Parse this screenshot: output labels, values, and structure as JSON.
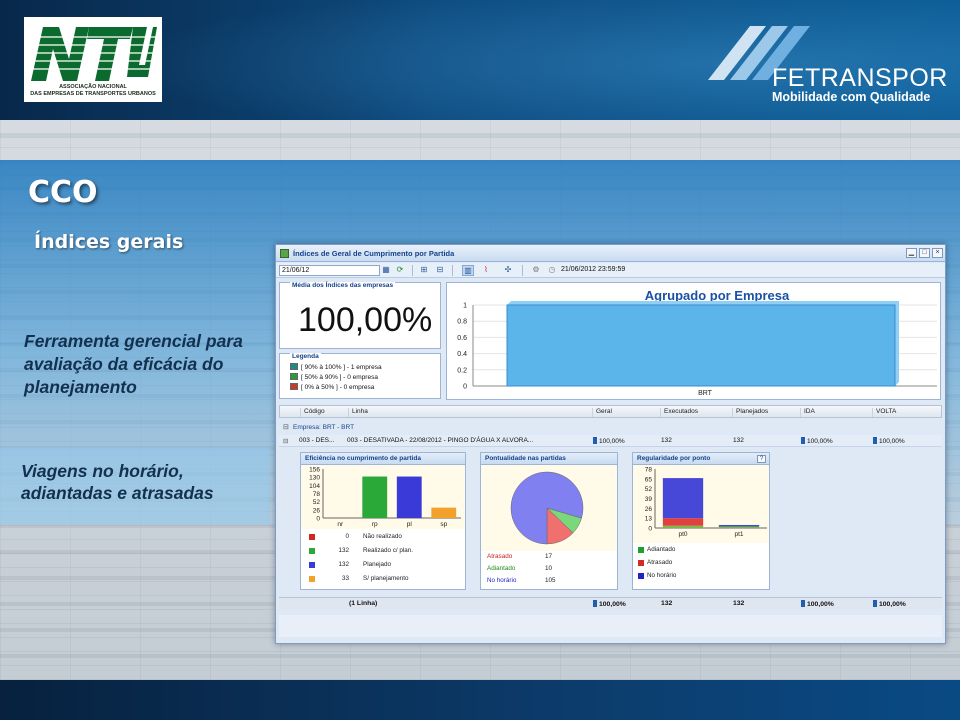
{
  "slide": {
    "title": "CCO",
    "subtitle": "Índices gerais",
    "tool_text": "Ferramenta gerencial para avaliação da eficácia do planejamento",
    "trips_text": "Viagens no horário, adiantadas e atrasadas"
  },
  "logos": {
    "ntu_mark": "NTU",
    "ntu_sub_1": "ASSOCIAÇÃO NACIONAL",
    "ntu_sub_2": "DAS EMPRESAS DE TRANSPORTES URBANOS",
    "fet_name": "FETRANSPOR",
    "fet_tagline": "Mobilidade com Qualidade"
  },
  "window": {
    "title": "Índices de Geral de Cumprimento por Partida",
    "date_value": "21/06/12",
    "datetime": "21/06/2012 23:59:59",
    "media_label": "Média dos Índices das empresas",
    "media_value": "100,00%",
    "legend_label": "Legenda",
    "legend": [
      {
        "text": "[ 90% à 100% ] - 1 empresa",
        "color": "#1f8a8a"
      },
      {
        "text": "[ 50% à 90% ] - 0 empresa",
        "color": "#2a9a3a"
      },
      {
        "text": "[ 0% à 50% ] - 0 empresa",
        "color": "#c83a2a"
      }
    ]
  },
  "columns": [
    "Código",
    "Linha",
    "Geral",
    "Executados",
    "Planejados",
    "IDA",
    "VOLTA"
  ],
  "group_label": "Empresa: BRT - BRT",
  "row": {
    "codigo": "003 - DES...",
    "linha": "003 - DESATIVADA - 22/08/2012 - PINGO D'ÁGUA X ALVORA...",
    "geral": "100,00%",
    "executados": "132",
    "planejados": "132",
    "ida": "100,00%",
    "volta": "100,00%"
  },
  "total": {
    "label": "(1 Linha)",
    "geral": "100,00%",
    "executados": "132",
    "planejados": "132",
    "ida": "100,00%",
    "volta": "100,00%"
  },
  "eficiencia": {
    "title": "Eficiência no cumprimento de partida",
    "list": [
      {
        "value": "0",
        "label": "Não realizado",
        "color": "#d42424"
      },
      {
        "value": "132",
        "label": "Realizado c/ plan.",
        "color": "#2aa838"
      },
      {
        "value": "132",
        "label": "Planejado",
        "color": "#3a3ad8"
      },
      {
        "value": "33",
        "label": "S/ planejamento",
        "color": "#f2a22a"
      }
    ]
  },
  "pontualidade": {
    "title": "Pontualidade nas partidas",
    "list": [
      {
        "label": "Atrasado",
        "value": "17",
        "color": "#c81e1e"
      },
      {
        "label": "Adiantado",
        "value": "10",
        "color": "#1c8a1c"
      },
      {
        "label": "No horário",
        "value": "105",
        "color": "#1c1cc8"
      }
    ]
  },
  "regularidade": {
    "title": "Regularidade por ponto",
    "help": "?",
    "list": [
      {
        "label": "Adiantado",
        "color": "#1ea02a"
      },
      {
        "label": "Atrasado",
        "color": "#d22a2a"
      },
      {
        "label": "No horário",
        "color": "#2222c8"
      }
    ]
  },
  "chart_data": [
    {
      "type": "bar",
      "title": "Agrupado por Empresa",
      "categories": [
        "BRT"
      ],
      "values": [
        1
      ],
      "ylim": [
        0,
        1
      ],
      "yticks": [
        "0",
        "0.2",
        "0.4",
        "0.6",
        "0.8",
        "1"
      ],
      "color": "#5bb4ea"
    },
    {
      "type": "bar",
      "categories": [
        "nr",
        "rp",
        "pl",
        "sp"
      ],
      "values": [
        0,
        132,
        132,
        33
      ],
      "ylim": [
        0,
        156
      ],
      "yticks": [
        "0",
        "26",
        "52",
        "78",
        "104",
        "130",
        "156"
      ],
      "colors": [
        "#d42424",
        "#2aa838",
        "#3a3ad8",
        "#f2a22a"
      ]
    },
    {
      "type": "pie",
      "categories": [
        "Atrasado",
        "Adiantado",
        "No horário"
      ],
      "values": [
        17,
        10,
        105
      ],
      "colors": [
        "#f07070",
        "#7ad87a",
        "#8080f0"
      ]
    },
    {
      "type": "bar",
      "stacked": true,
      "categories": [
        "pt0",
        "pt1"
      ],
      "series": [
        {
          "name": "Adiantado",
          "values": [
            3,
            2
          ],
          "color": "#7ab84a"
        },
        {
          "name": "Atrasado",
          "values": [
            10,
            0
          ],
          "color": "#e04040"
        },
        {
          "name": "No horário",
          "values": [
            53,
            2
          ],
          "color": "#4848d8"
        }
      ],
      "ylim": [
        0,
        78
      ],
      "yticks": [
        "0",
        "13",
        "26",
        "39",
        "52",
        "65",
        "78"
      ]
    }
  ]
}
